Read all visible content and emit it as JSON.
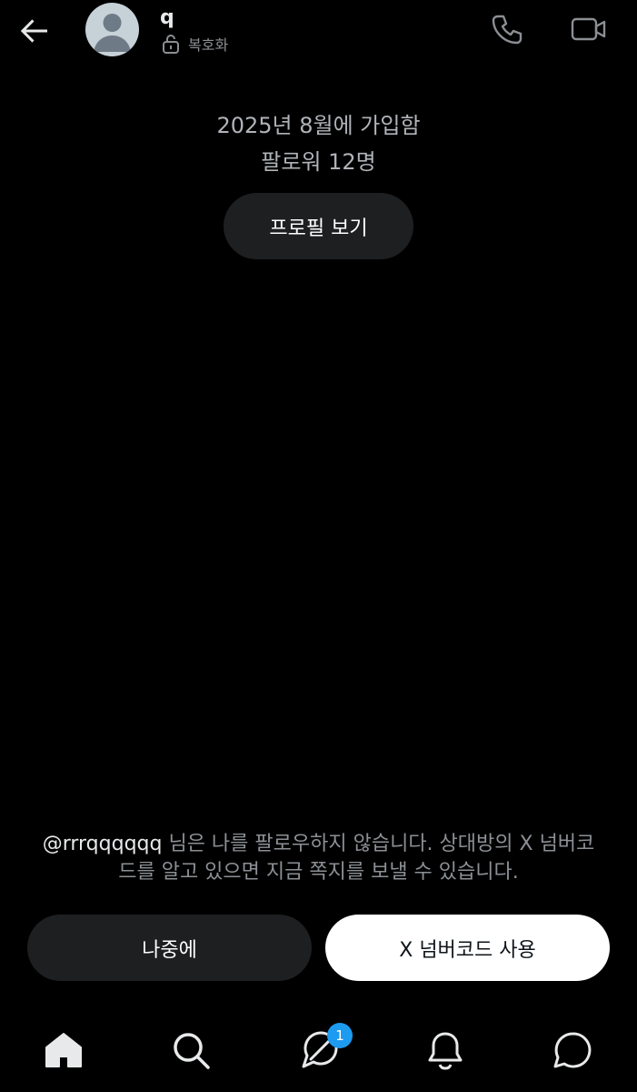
{
  "header": {
    "title": "q",
    "encryption_label": "복호화",
    "icons": [
      "back-arrow-icon",
      "avatar",
      "lock-icon",
      "phone-icon",
      "video-camera-icon"
    ]
  },
  "profile_info": {
    "joined": "2025년 8월에 가입함",
    "followers": "팔로워 12명",
    "view_profile_label": "프로필 보기"
  },
  "notice": {
    "handle": "@rrrqqqqqq",
    "message": " 님은 나를 팔로우하지 않습니다. 상대방의 X 넘버코드를 알고 있으면 지금 쪽지를 보낼 수 있습니다."
  },
  "actions": {
    "later_label": "나중에",
    "use_code_label": "X 넘버코드 사용"
  },
  "bottom_nav": {
    "items": [
      "home-icon",
      "search-icon",
      "messages-icon",
      "notifications-icon",
      "chat-icon"
    ],
    "messages_badge": "1"
  },
  "colors": {
    "background": "#000000",
    "button_dark": "#1e1f21",
    "button_light": "#ffffff",
    "badge": "#1d9bf0",
    "muted_text": "#8c9095"
  }
}
